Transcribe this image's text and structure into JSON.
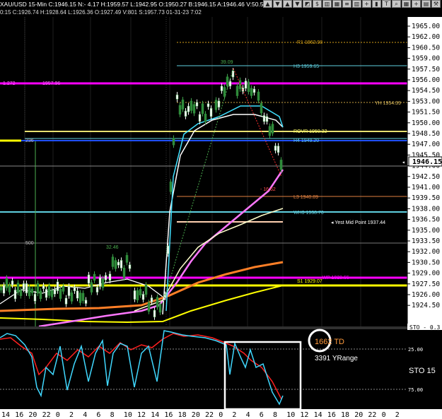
{
  "window": {
    "title": "XAU/USD 15-Min  C:1946.15  N:- 4.17  H:1959.57  L:1942.95  O:1950.27  B:1946.15  A:1946.46  V:50.5K  0",
    "toolbar_icons": [
      "up-arrow-icon",
      "down-arrow-icon",
      "up-arrow-icon",
      "down-arrow-icon",
      "chart-icon",
      "dollar-icon",
      "bars-icon",
      "grid-icon",
      "lines-icon",
      "bars-icon",
      "cross-icon",
      "candle-icon",
      "text-icon",
      "zoom-icon",
      "grid-icon",
      "cross-icon",
      "tile-icon",
      "tools-icon"
    ]
  },
  "ohlc_line": "0:15  C:1926.74  H:1928.64  L:1926.36  O:1927.49  V:801  S:1957.73  01-31-23  7:02",
  "price_axis": {
    "labels": [
      "1965.00",
      "1962.00",
      "1960.50",
      "1959.00",
      "1957.50",
      "1956.00",
      "1954.50",
      "1953.00",
      "1951.50",
      "1950.00",
      "1948.50",
      "1947.00",
      "1945.50",
      "1944.00",
      "1942.50",
      "1941.00",
      "1939.50",
      "1938.00",
      "1936.50",
      "1935.00",
      "1933.50",
      "1932.00",
      "1930.50",
      "1929.00",
      "1927.50",
      "1926.00",
      "1924.50"
    ],
    "current_price": "1946.15",
    "sto_label": "STO - 0.3",
    "current_price_color": "#ffffff"
  },
  "levels": [
    {
      "label": "R1 1962.98",
      "color": "#d4a017"
    },
    {
      "label": "H3 1959.65",
      "color": "#5fd0e0"
    },
    {
      "label": "1957.96",
      "color": "#ff00ff"
    },
    {
      "label": "YH 1954.39",
      "color": "#e0c060"
    },
    {
      "label": "ROVR 1950.32",
      "color": "#ffff66"
    },
    {
      "label": "H4 1949.20",
      "color": "#5fd0e0"
    },
    {
      "label": "L3 1940.89",
      "color": "#e08040"
    },
    {
      "label": "WH3 1938.70",
      "color": "#5fd0e0"
    },
    {
      "label": "Yest Mid Point 1937.44",
      "color": "#ffffff"
    },
    {
      "label": "WP 1929.55",
      "color": "#ff00ff"
    },
    {
      "label": "S1 1929.07",
      "color": "#ffff00"
    }
  ],
  "annotations": {
    "high_marker": "39.09",
    "swing_low": "- 16.62",
    "swing_left": "32.46",
    "fib_left": "1.272",
    "level_500": "500",
    "level_236": "236"
  },
  "stochastic": {
    "label": "STO  15",
    "tick_25": "25.00",
    "tick_75": "75.00",
    "td_text": "1662 TD",
    "yrange_text": "3391 YRange"
  },
  "time_axis": {
    "labels": [
      "14",
      "16",
      "20",
      "22",
      "0",
      "2",
      "4",
      "6",
      "8",
      "10",
      "12",
      "14",
      "16",
      "18",
      "20",
      "22",
      "0",
      "2",
      "4",
      "6",
      "8",
      "10",
      "12",
      "14",
      "16",
      "18",
      "20",
      "22",
      "0",
      "2"
    ]
  }
}
